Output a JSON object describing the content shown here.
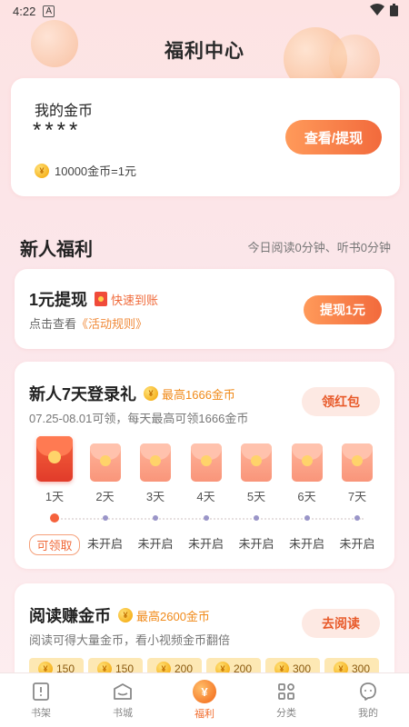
{
  "status": {
    "time": "4:22",
    "notification_glyph": "A"
  },
  "header": {
    "title": "福利中心"
  },
  "gold_card": {
    "label": "我的金币",
    "balance_masked": "****",
    "exchange_rate": "10000金币=1元",
    "view_button": "查看/提现"
  },
  "new_user": {
    "title": "新人福利",
    "note": "今日阅读0分钟、听书0分钟"
  },
  "withdraw": {
    "title": "1元提现",
    "tag": "快速到账",
    "sub_prefix": "点击查看",
    "sub_link": "《活动规则》",
    "button": "提现1元"
  },
  "login": {
    "title": "新人7天登录礼",
    "max": "最高1666金币",
    "sub": "07.25-08.01可领，每天最高可领1666金币",
    "button": "领红包",
    "days": [
      {
        "label": "1天",
        "state": "可领取",
        "active": true
      },
      {
        "label": "2天",
        "state": "未开启",
        "active": false
      },
      {
        "label": "3天",
        "state": "未开启",
        "active": false
      },
      {
        "label": "4天",
        "state": "未开启",
        "active": false
      },
      {
        "label": "5天",
        "state": "未开启",
        "active": false
      },
      {
        "label": "6天",
        "state": "未开启",
        "active": false
      },
      {
        "label": "7天",
        "state": "未开启",
        "active": false
      }
    ]
  },
  "reading": {
    "title": "阅读赚金币",
    "max": "最高2600金币",
    "sub": "阅读可得大量金币，看小视频金币翻倍",
    "button": "去阅读",
    "rewards": [
      "150",
      "150",
      "200",
      "200",
      "300",
      "300"
    ]
  },
  "tabs": [
    {
      "label": "书架",
      "icon": "bookshelf-icon",
      "active": false
    },
    {
      "label": "书城",
      "icon": "bookstore-icon",
      "active": false
    },
    {
      "label": "福利",
      "icon": "welfare-icon",
      "active": true
    },
    {
      "label": "分类",
      "icon": "category-icon",
      "active": false
    },
    {
      "label": "我的",
      "icon": "profile-icon",
      "active": false
    }
  ],
  "colors": {
    "accent": "#f26a3c",
    "tab_active": "#f06a2a",
    "claim": "#f06a3a"
  }
}
